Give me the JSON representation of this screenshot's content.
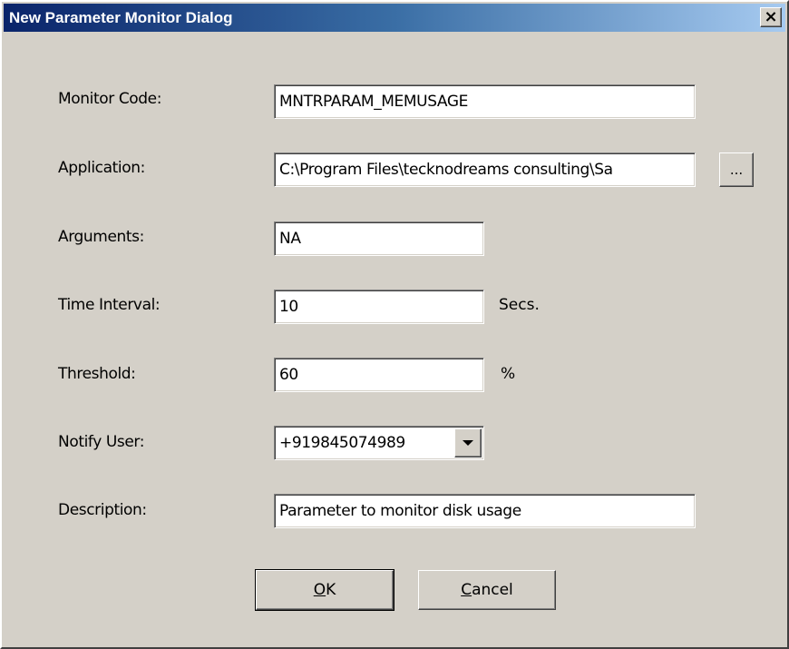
{
  "window": {
    "title": "New Parameter Monitor Dialog",
    "close_label": "×"
  },
  "form": {
    "monitor_code": {
      "label": "Monitor Code:",
      "value": "MNTRPARAM_MEMUSAGE"
    },
    "application": {
      "label": "Application:",
      "value": "C:\\Program Files\\tecknodreams consulting\\Sa",
      "browse_label": "..."
    },
    "arguments": {
      "label": "Arguments:",
      "value": "NA"
    },
    "time_interval": {
      "label": "Time Interval:",
      "value": "10",
      "unit": "Secs."
    },
    "threshold": {
      "label": "Threshold:",
      "value": "60",
      "unit": "%"
    },
    "notify_user": {
      "label": "Notify User:",
      "value": "+919845074989"
    },
    "description": {
      "label": "Description:",
      "value": "Parameter to monitor disk usage"
    }
  },
  "buttons": {
    "ok_mnemonic": "O",
    "ok_rest": "K",
    "cancel_mnemonic": "C",
    "cancel_rest": "ancel"
  },
  "icons": {
    "close": "close-icon",
    "dropdown": "chevron-down-icon"
  },
  "colors": {
    "dialog_bg": "#d4d0c8",
    "titlebar_start": "#0a246a",
    "titlebar_end": "#a6caf0",
    "field_bg": "#ffffff"
  }
}
